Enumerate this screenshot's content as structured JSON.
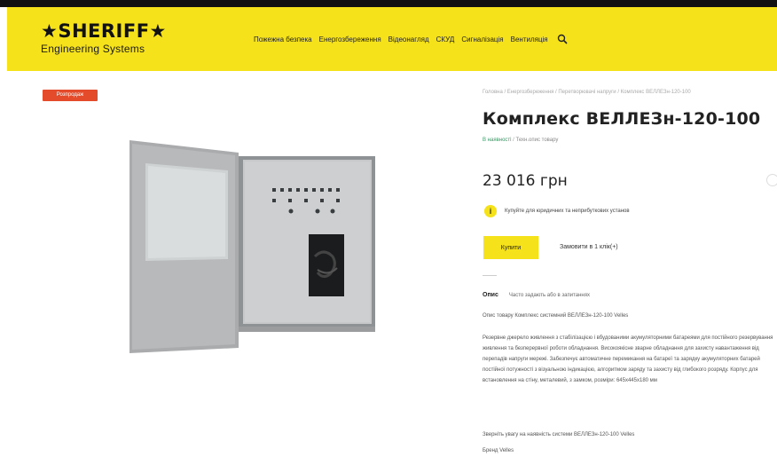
{
  "brand": {
    "name": "★SHERIFF★",
    "tagline": "Engineering Systems"
  },
  "nav": {
    "items": [
      "Пожежна безпека",
      "Енергозбереження",
      "Відеонагляд",
      "СКУД",
      "Сигналізація",
      "Вентиляція"
    ],
    "search_icon": "search-icon"
  },
  "product": {
    "badge": "Розпродаж",
    "breadcrumb": "Головна  /  Енергозбереження  /  Перетворювачі напруги  /  Комплекс ВЕЛЛЕЗн-120-100",
    "title": "Комплекс ВЕЛЛЕЗн-120-100",
    "stock": "В наявності",
    "stock_separator": "/",
    "code": "Техн.опис товару",
    "price": "23 016 грн",
    "notice": "Купуйте для юридичних та неприбуткових установ",
    "buy_label": "Купити",
    "quick_order_label": "Замовити в 1 клік(+)",
    "tabs": [
      "Опис",
      "Часто задають або в запитаннях"
    ]
  },
  "description": {
    "line1": "Опис товару Комплекс системний ВЕЛЛЕЗн-120-100 Velles",
    "paragraph": "Резервне джерело живлення з стабілізацією і вбудованими акумуляторними батареями для постійного резервування живлення та безперервної роботи обладнання. Високоякісне зварне обладнання для захисту навантаження від перепадів напруги мережі. Забезпечує автоматичне перемикання на батареї та зарядку акумуляторних батарей постійної потужності з візуальною індикацією, алгоритмом заряду та захисту від глибокого розряду. Корпус для встановлення на стіну, металевий, з замком, розміри: 645х445х180 мм",
    "line3": "Зверніть увагу на наявність системи ВЕЛЛЕЗн-120-100 Velles",
    "line4": "Бренд Velles"
  },
  "colors": {
    "header_yellow": "#f5e21b",
    "badge_red": "#e34b2b",
    "stock_green": "#3a9a66"
  }
}
